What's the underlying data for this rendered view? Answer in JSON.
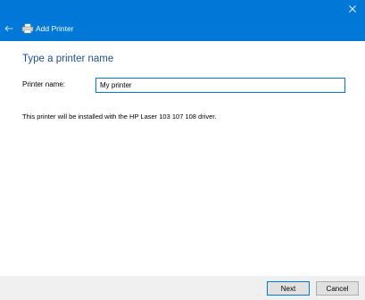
{
  "window": {
    "title": "Add Printer",
    "back_icon": "back-arrow-icon",
    "close_icon": "close-icon",
    "app_icon": "printer-icon",
    "accent_color": "#0078d7"
  },
  "page": {
    "heading": "Type a printer name",
    "printer_name_label": "Printer name:",
    "printer_name_value": "My printer",
    "driver_info": "This printer will be installed with the HP Laser 103 107 108 driver."
  },
  "footer": {
    "next_label": "Next",
    "cancel_label": "Cancel"
  }
}
